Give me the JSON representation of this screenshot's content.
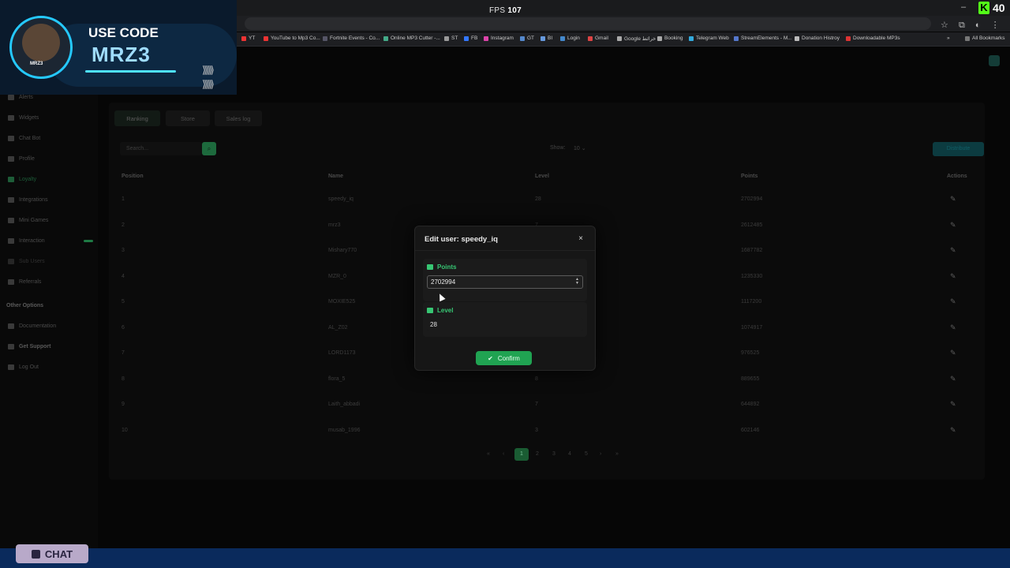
{
  "topbar": {
    "fps_label": "FPS",
    "fps_value": "107",
    "kick_logo": "K",
    "kick_count": "40",
    "minimize": "–"
  },
  "toolbar": {
    "star_icon": "☆",
    "ext_icon": "⧉",
    "profile_icon": "◐",
    "menu_icon": "⋮"
  },
  "bookmarks": {
    "items": [
      "YT",
      "YouTube to Mp3 Co...",
      "Fortnite Events - Co...",
      "Online MP3 Cutter -...",
      "ST",
      "FB",
      "Instagram",
      "GT",
      "BI",
      "Login",
      "Gmail",
      "Google خرائط",
      "Booking",
      "Telegram Web",
      "StreamElements - M...",
      "Donation Histroy",
      "Downloadable MP3s"
    ],
    "more": "»",
    "all_bookmarks": "All Bookmarks"
  },
  "overlay": {
    "use_code": "USE CODE",
    "code": "MRZ3",
    "avatar_tag": "MRZ3",
    "arrows": "⟫⟫⟫"
  },
  "sidebar": {
    "items": [
      "Alerts",
      "Widgets",
      "Chat Bot",
      "Profile",
      "Loyalty",
      "Integrations",
      "Mini Games",
      "Interaction",
      "Sub Users",
      "Referrals"
    ],
    "other_heading": "Other Options",
    "other_items": [
      "Documentation",
      "Get Support",
      "Log Out"
    ]
  },
  "tabs": [
    "Ranking",
    "Store",
    "Sales log"
  ],
  "filters": {
    "search_placeholder": "Search...",
    "search_icon": "⌕",
    "show_label": "Show:",
    "show_value": "10",
    "chevron": "⌄",
    "action_button": "Distribute"
  },
  "table": {
    "headers": [
      "Position",
      "Name",
      "Level",
      "Points",
      "Actions"
    ],
    "rows": [
      {
        "position": "1",
        "name": "speedy_iq",
        "level": "28",
        "points": "2702994"
      },
      {
        "position": "2",
        "name": "mrz3",
        "level": "7",
        "points": "2612485"
      },
      {
        "position": "3",
        "name": "Mishary770",
        "level": "",
        "points": "1687782"
      },
      {
        "position": "4",
        "name": "MZR_0",
        "level": "",
        "points": "1235330"
      },
      {
        "position": "5",
        "name": "MOXIE525",
        "level": "",
        "points": "1117200"
      },
      {
        "position": "6",
        "name": "AL_Z02",
        "level": "",
        "points": "1074917"
      },
      {
        "position": "7",
        "name": "LORD1173",
        "level": "",
        "points": "976525"
      },
      {
        "position": "8",
        "name": "flora_5",
        "level": "8",
        "points": "889655"
      },
      {
        "position": "9",
        "name": "Laith_abbadi",
        "level": "7",
        "points": "644892"
      },
      {
        "position": "10",
        "name": "musab_1996",
        "level": "3",
        "points": "602146"
      }
    ],
    "edit_icon": "✎"
  },
  "pagination": {
    "first": "«",
    "prev": "‹",
    "pages": [
      "1",
      "2",
      "3",
      "4",
      "5"
    ],
    "next": "›",
    "last": "»"
  },
  "modal": {
    "title": "Edit user: speedy_iq",
    "close_icon": "×",
    "points_label": "Points",
    "points_value": "2702994",
    "level_label": "Level",
    "level_value": "28",
    "confirm_label": "Confirm",
    "check_icon": "✔"
  },
  "bottom": {
    "chat_label": "CHAT"
  }
}
